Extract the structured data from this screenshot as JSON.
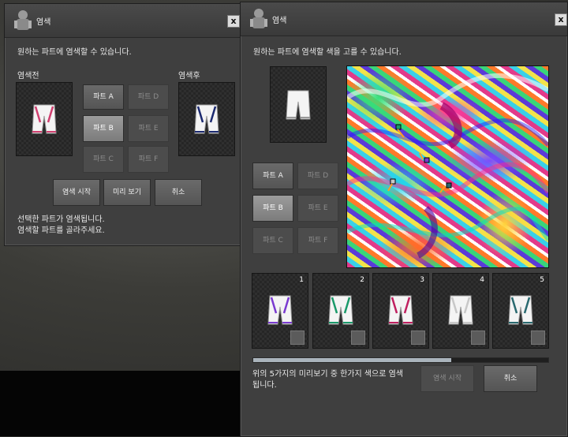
{
  "left_window": {
    "title": "염색",
    "close_label": "x",
    "instruction": "원하는 파트에 염색할 수 있습니다.",
    "before_label": "염색전",
    "after_label": "염색후",
    "parts": [
      {
        "label": "파트 A",
        "state": "enabled"
      },
      {
        "label": "파트 B",
        "state": "selected"
      },
      {
        "label": "파트 C",
        "state": "disabled"
      },
      {
        "label": "파트 D",
        "state": "disabled"
      },
      {
        "label": "파트 E",
        "state": "disabled"
      },
      {
        "label": "파트 F",
        "state": "disabled"
      }
    ],
    "buttons": {
      "start": "염색 시작",
      "preview": "미리 보기",
      "cancel": "취소"
    },
    "status_line1": "선택한 파트가 염색됩니다.",
    "status_line2": "염색할 파트를 골라주세요.",
    "item_before_color": "#d04070",
    "item_after_color": "#1c2a70"
  },
  "right_window": {
    "title": "염색",
    "close_label": "x",
    "instruction": "원하는 파트에 염색할 색을 고를 수 있습니다.",
    "parts": [
      {
        "label": "파트 A",
        "state": "enabled"
      },
      {
        "label": "파트 B",
        "state": "selected"
      },
      {
        "label": "파트 C",
        "state": "disabled"
      },
      {
        "label": "파트 D",
        "state": "disabled"
      },
      {
        "label": "파트 E",
        "state": "disabled"
      },
      {
        "label": "파트 F",
        "state": "disabled"
      }
    ],
    "previews": [
      {
        "number": "1",
        "color": "#7a3ad0"
      },
      {
        "number": "2",
        "color": "#1a9a6a"
      },
      {
        "number": "3",
        "color": "#c02060"
      },
      {
        "number": "4",
        "color": "#c8c8c8"
      },
      {
        "number": "5",
        "color": "#2a6a70"
      }
    ],
    "progress_fraction": 0.67,
    "footer_line1": "위의 5가지의 미리보기 중 한가지 색으로 염색",
    "footer_line2": "됩니다.",
    "buttons": {
      "start": "염색 시작",
      "cancel": "취소"
    }
  },
  "colors": {
    "panel": "#3f3f3f",
    "button": "#606060",
    "selected_button": "#8c8c8c"
  }
}
